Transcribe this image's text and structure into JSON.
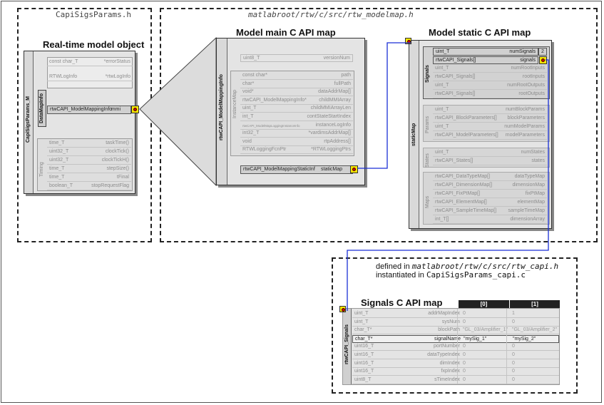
{
  "files": {
    "params_header": "CapiSigsParams.h",
    "modelmap_header": "matlabroot/rtw/c/src/rtw_modelmap.h",
    "capi_defined_prefix": "defined in ",
    "capi_defined_path": "matlabroot/rtw/c/src/rtw_capi.h",
    "capi_inst_prefix": "instantiated in ",
    "capi_inst_file": "CapiSigsParams_capi.c"
  },
  "titles": {
    "rt_model": "Real-time model object",
    "main_map": "Model main C API map",
    "static_map": "Model static C API map",
    "signals_map": "Signals C API map"
  },
  "rt_model": {
    "side_label": "CapiSigsParams_M",
    "top_rows": [
      {
        "type": "const char_T",
        "name": "*errorStatus"
      },
      {
        "type": "RTWLogInfo",
        "name": "*rtwLogInfo"
      }
    ],
    "datamap_label": "DataMapInfo",
    "mmi_row": {
      "type": "rtwCAPI_ModelMappingInfo",
      "name": "mmi"
    },
    "timing_label": "Timing",
    "timing_rows": [
      {
        "type": "time_T",
        "name": "taskTime()"
      },
      {
        "type": "uint32_T",
        "name": "clockTick()"
      },
      {
        "type": "uint32_T",
        "name": "clockTickH()"
      },
      {
        "type": "time_T",
        "name": "stepSize()"
      },
      {
        "type": "time_T",
        "name": "tFinal"
      },
      {
        "type": "boolean_T",
        "name": "stopRequestFlag"
      }
    ]
  },
  "main_map": {
    "side_label": "rtwCAPI_ModelMappingInfo",
    "version_row": {
      "type": "uint8_T",
      "name": "versionNum"
    },
    "instance_label": "InstanceMap",
    "rows": [
      {
        "type": "const char*",
        "name": "path"
      },
      {
        "type": "char*",
        "name": "fullPath"
      },
      {
        "type": "void*",
        "name": "dataAddrMap[]"
      },
      {
        "type": "rtwCAPI_ModelMappingInfo*",
        "name": "childMMIArray"
      },
      {
        "type": "uint_T",
        "name": "childMMIArrayLen"
      },
      {
        "type": "int_T",
        "name": "contStateStartIndex"
      },
      {
        "type": "rtwCAPI_ModelMapLoggingInstanceInfo",
        "name": "instanceLogInfo"
      },
      {
        "type": "int32_T",
        "name": "*vardimsAddrMap[]"
      },
      {
        "type": "void",
        "name": "rtpAddress[]"
      },
      {
        "type": "RTWLoggingFcnPtr",
        "name": "*RTWLoggingPtrs"
      }
    ],
    "static_row": {
      "type": "rtwCAPI_ModelMappingStaticInf",
      "name": "staticMap"
    }
  },
  "static_map": {
    "side_label": "staticMap",
    "groups": [
      {
        "label": "Signals",
        "rows": [
          {
            "type": "uint_T",
            "name": "numSignals",
            "val": "2"
          },
          {
            "type": "rtwCAPI_Signals[]",
            "name": "signals"
          },
          {
            "type": "uint_T",
            "name": "numRootInputs"
          },
          {
            "type": "rtwCAPI_Signals[]",
            "name": "rootInputs"
          },
          {
            "type": "uint_T",
            "name": "numRootOutputs"
          },
          {
            "type": "rtwCAPI_Signals[]",
            "name": "rootOutputs"
          }
        ]
      },
      {
        "label": "Params",
        "rows": [
          {
            "type": "uint_T",
            "name": "numBlockParams"
          },
          {
            "type": "rtwCAPI_BlockParameters[]",
            "name": "blockParameters"
          },
          {
            "type": "uint_T",
            "name": "numModelParams"
          },
          {
            "type": "rtwCAPI_ModelParameters[]",
            "name": "modelParameters"
          }
        ]
      },
      {
        "label": "States",
        "rows": [
          {
            "type": "uint_T",
            "name": "numStates"
          },
          {
            "type": "rtwCAPI_States[]",
            "name": "states"
          }
        ]
      },
      {
        "label": "Maps",
        "rows": [
          {
            "type": "rtwCAPI_DataTypeMap[]",
            "name": "dataTypeMap"
          },
          {
            "type": "rtwCAPI_DimensionMap[]",
            "name": "dimensionMap"
          },
          {
            "type": "rtwCAPI_FixPtMap[]",
            "name": "fixPtMap"
          },
          {
            "type": "rtwCAPI_ElementMap[]",
            "name": "elementMap"
          },
          {
            "type": "rtwCAPI_SampleTimeMap[]",
            "name": "sampleTimeMap"
          },
          {
            "type": "int_T[]",
            "name": "dimensionArray"
          }
        ]
      }
    ]
  },
  "signals_map": {
    "side_label": "rtwCAPI_Signals",
    "columns": [
      "[0]",
      "[1]"
    ],
    "rows": [
      {
        "type": "uint_T",
        "name": "addrMapIndex",
        "v0": "0",
        "v1": "1"
      },
      {
        "type": "uint_T",
        "name": "sysNum",
        "v0": "0",
        "v1": "0"
      },
      {
        "type": "char_T*",
        "name": "blockPath",
        "v0": "\"GL_03/Amplifier_1\"",
        "v1": "\"GL_03/Amplifier_2\""
      },
      {
        "type": "char_T*",
        "name": "signalName",
        "v0": "\"mySig_1\"",
        "v1": "\"mySig_2\""
      },
      {
        "type": "uint16_T",
        "name": "portNumber",
        "v0": "0",
        "v1": "0"
      },
      {
        "type": "uint16_T",
        "name": "dataTypeIndex",
        "v0": "0",
        "v1": "0"
      },
      {
        "type": "uint16_T",
        "name": "dimIndex",
        "v0": "0",
        "v1": "0"
      },
      {
        "type": "uint16_T",
        "name": "fxpIndex",
        "v0": "0",
        "v1": "0"
      },
      {
        "type": "uint8_T",
        "name": "sTimeIndex",
        "v0": "0",
        "v1": "0"
      }
    ]
  },
  "colors": {
    "connector": "#1a2fd6",
    "port_fill": "#f4e400",
    "port_dot": "#d80000"
  }
}
